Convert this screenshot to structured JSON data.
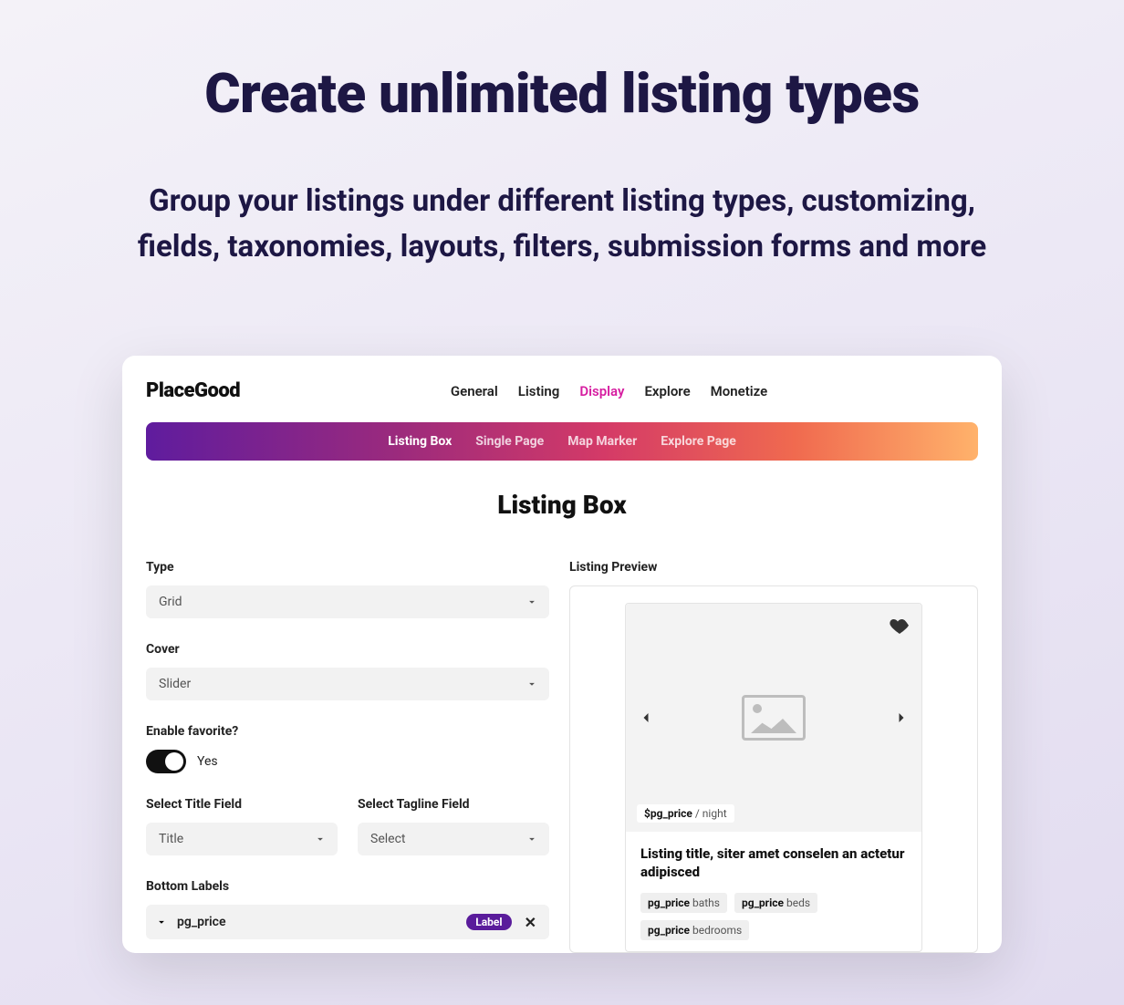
{
  "hero": {
    "title": "Create unlimited listing types",
    "subtitle": "Group your listings under different listing types, customizing, fields, taxonomies, layouts, filters, submission forms and more"
  },
  "app": {
    "logo": "PlaceGood",
    "topnav": [
      "General",
      "Listing",
      "Display",
      "Explore",
      "Monetize"
    ],
    "topnav_active": 2,
    "subnav": [
      "Listing Box",
      "Single Page",
      "Map Marker",
      "Explore Page"
    ],
    "subnav_active": 0,
    "section_title": "Listing Box"
  },
  "form": {
    "type_label": "Type",
    "type_value": "Grid",
    "cover_label": "Cover",
    "cover_value": "Slider",
    "favorite_label": "Enable favorite?",
    "favorite_value": "Yes",
    "title_field_label": "Select Title Field",
    "title_field_value": "Title",
    "tagline_field_label": "Select Tagline Field",
    "tagline_field_value": "Select",
    "bottom_labels_label": "Bottom Labels",
    "bottom_label_item": "pg_price",
    "bottom_label_badge": "Label"
  },
  "preview": {
    "label": "Listing Preview",
    "price_prefix": "$pg_price",
    "price_suffix": " / night",
    "card_title": "Listing title, siter amet conselen an actetur adipisced",
    "tags": [
      {
        "key": "pg_price",
        "suffix": " baths"
      },
      {
        "key": "pg_price",
        "suffix": " beds"
      },
      {
        "key": "pg_price",
        "suffix": " bedrooms"
      }
    ]
  }
}
